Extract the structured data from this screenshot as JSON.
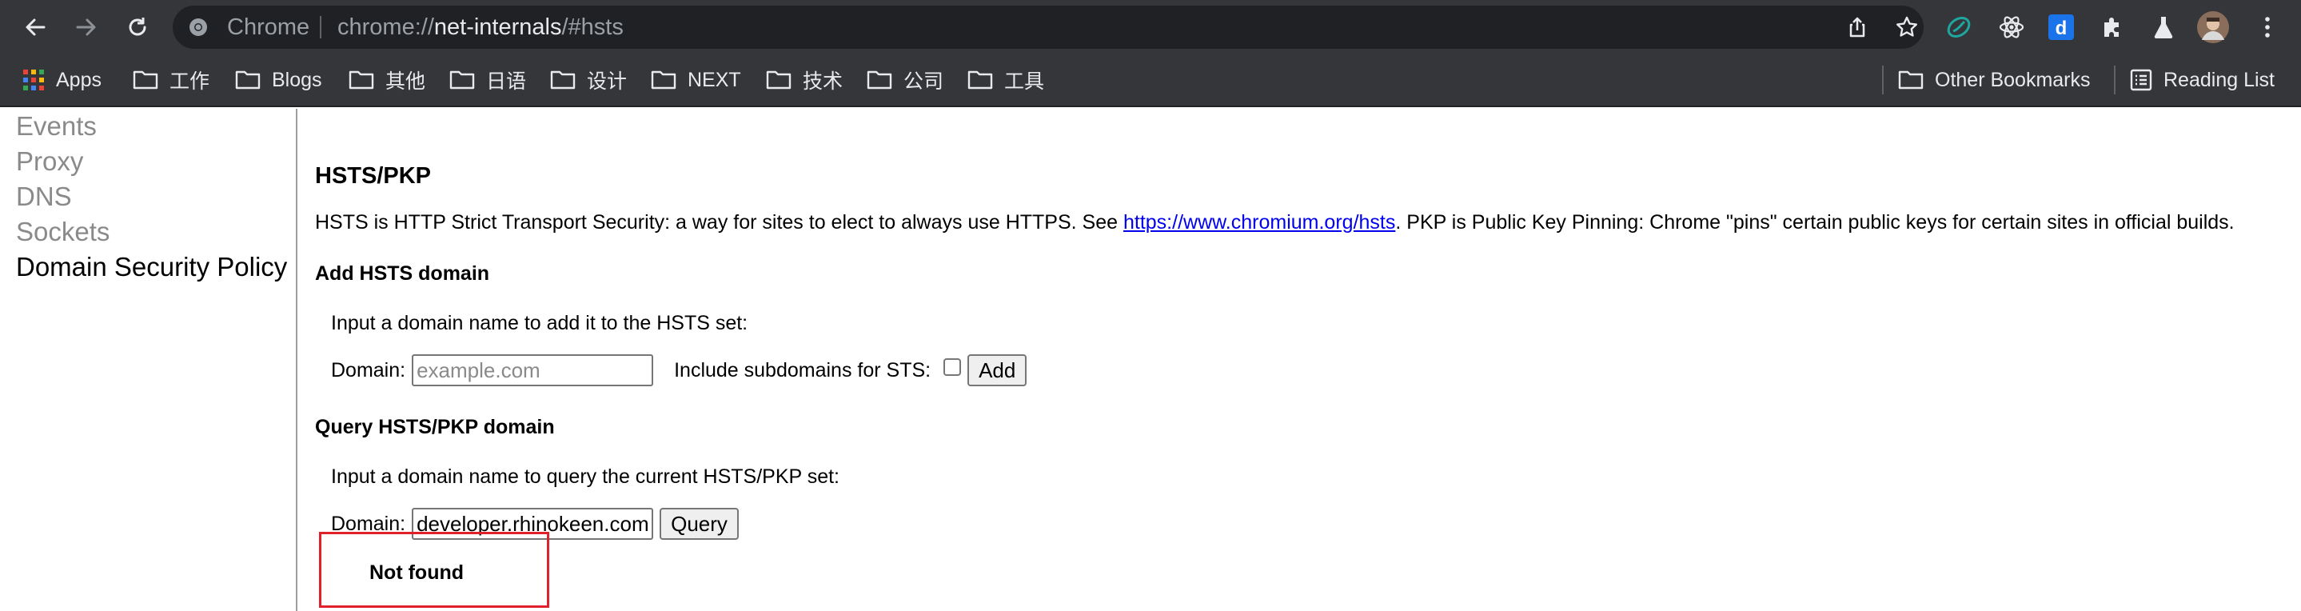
{
  "browser": {
    "omnibox": {
      "chip": "Chrome",
      "scheme": "chrome://",
      "host": "net-internals",
      "path": "/#hsts"
    },
    "toolbar_icons": [
      "back-arrow-icon",
      "forward-arrow-icon",
      "reload-icon",
      "share-icon",
      "bookmark-star-icon"
    ],
    "extensions": [
      "extension-spiral-icon",
      "extension-react-icon",
      "extension-d-icon",
      "puzzle-icon",
      "flask-icon",
      "profile-avatar",
      "kebab-menu-icon"
    ]
  },
  "bookmarks": {
    "apps_label": "Apps",
    "items": [
      "工作",
      "Blogs",
      "其他",
      "日语",
      "设计",
      "NEXT",
      "技术",
      "公司",
      "工具"
    ],
    "other_label": "Other Bookmarks",
    "reading_list_label": "Reading List"
  },
  "sidebar": {
    "items": [
      "Events",
      "Proxy",
      "DNS",
      "Sockets",
      "Domain Security Policy"
    ],
    "selected": "Domain Security Policy"
  },
  "main": {
    "title": "HSTS/PKP",
    "desc_before": "HSTS is HTTP Strict Transport Security: a way for sites to elect to always use HTTPS. See ",
    "desc_link": "https://www.chromium.org/hsts",
    "desc_after": ". PKP is Public Key Pinning: Chrome \"pins\" certain public keys for certain sites in official builds.",
    "add": {
      "heading": "Add HSTS domain",
      "instruction": "Input a domain name to add it to the HSTS set:",
      "domain_label": "Domain:",
      "domain_placeholder": "example.com",
      "subdomains_label": "Include subdomains for STS:",
      "button": "Add"
    },
    "query": {
      "heading": "Query HSTS/PKP domain",
      "instruction": "Input a domain name to query the current HSTS/PKP set:",
      "domain_label": "Domain:",
      "domain_value": "developer.rhinokeen.com",
      "button": "Query",
      "result": "Not found"
    }
  },
  "colors": {
    "chrome_bg": "#35363a",
    "omnibox_bg": "#202124",
    "link": "#0000ee",
    "highlight": "#e0202a"
  }
}
